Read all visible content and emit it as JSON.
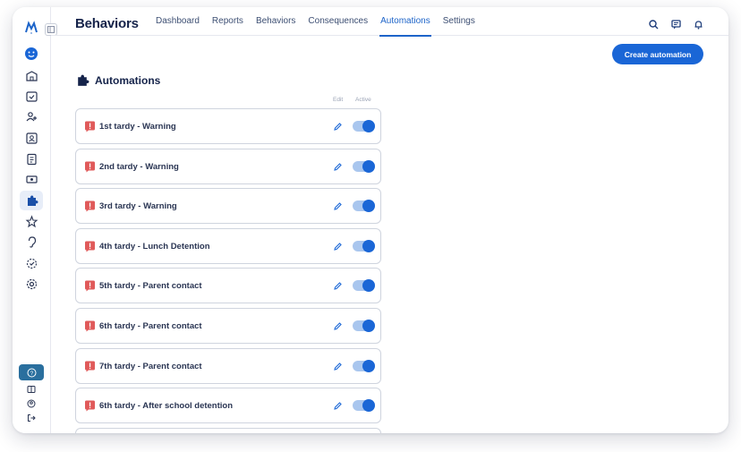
{
  "app": {
    "title": "Behaviors"
  },
  "nav": {
    "items": [
      {
        "label": "Dashboard"
      },
      {
        "label": "Reports"
      },
      {
        "label": "Behaviors"
      },
      {
        "label": "Consequences"
      },
      {
        "label": "Automations"
      },
      {
        "label": "Settings"
      }
    ],
    "active": "Automations"
  },
  "header_icons": [
    "search-icon",
    "chat-icon",
    "bell-icon"
  ],
  "toolbar": {
    "create_label": "Create automation"
  },
  "page": {
    "title": "Automations",
    "col_edit": "Edit",
    "col_active": "Active"
  },
  "automations": [
    {
      "label": "1st tardy - Warning",
      "active": true
    },
    {
      "label": "2nd tardy - Warning",
      "active": true
    },
    {
      "label": "3rd tardy - Warning",
      "active": true
    },
    {
      "label": "4th tardy - Lunch Detention",
      "active": true
    },
    {
      "label": "5th tardy - Parent contact",
      "active": true
    },
    {
      "label": "6th tardy - Parent contact",
      "active": true
    },
    {
      "label": "7th tardy - Parent contact",
      "active": true
    },
    {
      "label": "6th tardy - After school detention",
      "active": true
    }
  ],
  "sidebar": {
    "items": [
      "smile-icon",
      "school-icon",
      "calendar-check-icon",
      "users-icon",
      "id-card-icon",
      "clipboard-icon",
      "ticket-icon",
      "puzzle-icon",
      "star-icon",
      "ear-icon",
      "progress-icon",
      "gear-icon"
    ],
    "active": "puzzle-icon",
    "bottom": [
      "help-icon",
      "book-icon",
      "account-icon",
      "logout-icon"
    ]
  },
  "colors": {
    "accent": "#1a66d6",
    "title": "#15234a",
    "alert": "#e05a5a",
    "help": "#2a6f9e"
  }
}
